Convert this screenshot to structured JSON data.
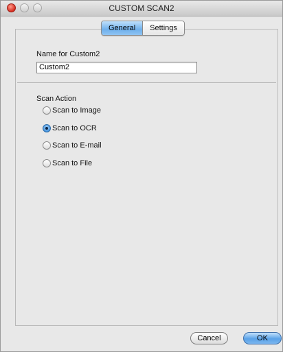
{
  "window": {
    "title": "CUSTOM SCAN2"
  },
  "tabs": [
    {
      "label": "General",
      "active": true
    },
    {
      "label": "Settings",
      "active": false
    }
  ],
  "name_section": {
    "label": "Name for Custom2",
    "value": "Custom2"
  },
  "scan_action": {
    "label": "Scan Action",
    "options": [
      {
        "label": "Scan to Image",
        "selected": false
      },
      {
        "label": "Scan to OCR",
        "selected": true
      },
      {
        "label": "Scan to E-mail",
        "selected": false
      },
      {
        "label": "Scan to File",
        "selected": false
      }
    ]
  },
  "buttons": {
    "cancel": "Cancel",
    "ok": "OK"
  },
  "colors": {
    "accent_blue": "#6fb0ec",
    "close_red": "#d62d20",
    "panel_bg": "#e8e8e8"
  }
}
